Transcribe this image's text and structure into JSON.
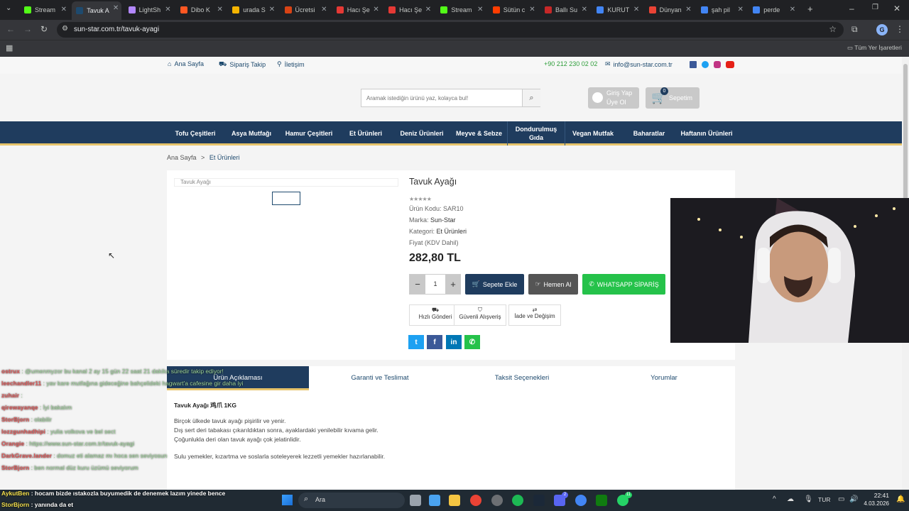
{
  "browser": {
    "tabs": [
      {
        "title": "Stream",
        "color": "#53fc18"
      },
      {
        "title": "Tavuk A",
        "color": "#1e4a6e",
        "active": true
      },
      {
        "title": "LightSh",
        "color": "#b388ff"
      },
      {
        "title": "Dibo K",
        "color": "#ff5722"
      },
      {
        "title": "urada S",
        "color": "#f4b400"
      },
      {
        "title": "Ücretsi",
        "color": "#d84315"
      },
      {
        "title": "Hacı Şe",
        "color": "#e53935"
      },
      {
        "title": "Hacı Şe",
        "color": "#e53935"
      },
      {
        "title": "Stream",
        "color": "#53fc18"
      },
      {
        "title": "Sütün c",
        "color": "#ff3d00"
      },
      {
        "title": "Ballı Su",
        "color": "#c62828"
      },
      {
        "title": "KURUT",
        "color": "#4285f4"
      },
      {
        "title": "Dünyan",
        "color": "#ea4335"
      },
      {
        "title": "şah pil",
        "color": "#4285f4"
      },
      {
        "title": "perde",
        "color": "#4285f4"
      }
    ],
    "url": "sun-star.com.tr/tavuk-ayagi",
    "bookmarks_label": "Tüm Yer İşaretleri",
    "profile_initial": "G"
  },
  "site": {
    "topbar": {
      "home": "Ana Sayfa",
      "track": "Sipariş Takip",
      "contact": "İletişim",
      "phone": "+90 212 230 02 02",
      "email": "info@sun-star.com.tr"
    },
    "search_placeholder": "Aramak istediğin ürünü yaz, kolayca bul!",
    "login": "Giriş Yap",
    "register": "Üye Ol",
    "cart_label": "Sepetim",
    "cart_count": "0",
    "nav": [
      "Tofu Çeşitleri",
      "Asya Mutfağı",
      "Hamur Çeşitleri",
      "Et Ürünleri",
      "Deniz Ürünleri",
      "Meyve & Sebze",
      "Dondurulmuş Gıda",
      "Vegan Mutfak",
      "Baharatlar",
      "Haftanın Ürünleri"
    ],
    "breadcrumb": {
      "home": "Ana Sayfa",
      "sep": ">",
      "current": "Et Ürünleri"
    },
    "product": {
      "image_alt": "Tavuk Ayağı",
      "title": "Tavuk Ayağı",
      "rating": 0,
      "code_label": "Ürün Kodu:",
      "code": "SAR10",
      "brand_label": "Marka:",
      "brand": "Sun-Star",
      "category_label": "Kategori:",
      "category": "Et Ürünleri",
      "price_label": "Fiyat (KDV Dahil)",
      "price": "282,80 TL",
      "qty": "1",
      "add_to_cart": "Sepete Ekle",
      "buy_now": "Hemen Al",
      "whatsapp": "WHATSAPP SİPARİŞ",
      "features": [
        "Hızlı Gönderi",
        "Güvenli Alışveriş",
        "İade ve Değişim"
      ]
    },
    "tabs": [
      "Ürün Açıklaması",
      "Garanti ve Teslimat",
      "Taksit Seçenekleri",
      "Yorumlar"
    ],
    "description": {
      "heading": "Tavuk Ayağı 鸡爪 1KG",
      "p1": "Birçok ülkede tavuk ayağı pişirilir ve yenir.",
      "p2": "Dış sert deri tabakası çıkarıldıktan sonra, ayaklardaki yenilebilir kıvama gelir.",
      "p3": "Çoğunlukla deri olan tavuk ayağı çok jelatinlidir.",
      "p4": "Sulu yemekler, kızartma ve soslarla soteleyerek lezzetli yemekler hazırlanabilir."
    }
  },
  "chat": [
    {
      "user": "ostrux",
      "msg": ": @umenmyzor bu kanal 2 ay 15 gün 22 saat 21 dakika süredir takip ediyor!"
    },
    {
      "user": "leechandler11",
      "msg": ": yav kare mutfağına gideceğine bahçelideki hagwart'a cafesine gir daha iyi"
    },
    {
      "user": "zuhair",
      "msg": ":"
    },
    {
      "user": "qirewayanqe",
      "msg": ": İyi bakalım"
    },
    {
      "user": "StorBjorn",
      "msg": ": olabilir"
    },
    {
      "user": "lozzgunhadhipi",
      "msg": ": yulia volkova ve bel sect"
    },
    {
      "user": "Orangie",
      "msg": ": https://www.sun-star.com.tr/tavuk-ayagi"
    },
    {
      "user": "DarkGrave.lander",
      "msg": ": domuz eti alamaz mı hoca sen seviyosun"
    },
    {
      "user": "StorBjorn",
      "msg": ": ben normal düz kuru üzümü seviyorum"
    },
    {
      "user": "AykutBen",
      "msg": ": hocam bizde ıstakozla buyumedik de denemek lazım yinede bence"
    },
    {
      "user": "StorBjorn",
      "msg": ": yanında da et"
    }
  ],
  "taskbar": {
    "search": "Ara",
    "lang": "TUR",
    "time": "22:41",
    "date": "4.03.2026",
    "badge1": "2",
    "badge2": "11"
  }
}
